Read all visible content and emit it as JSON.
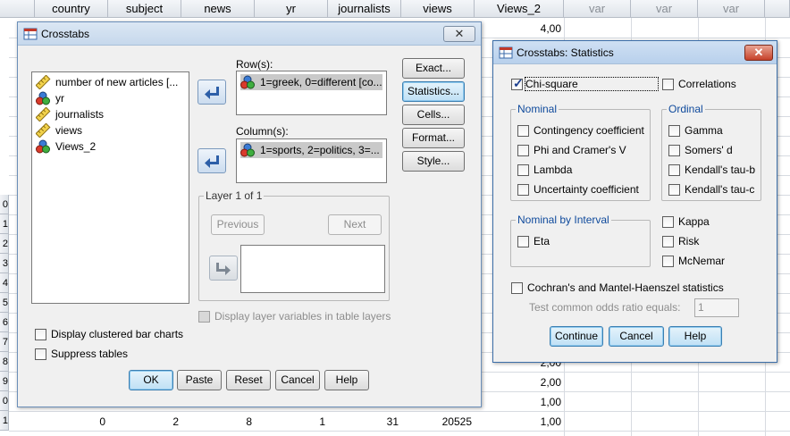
{
  "spreadsheet": {
    "columns": [
      "country",
      "subject",
      "news",
      "yr",
      "journalists",
      "views",
      "Views_2",
      "var",
      "var",
      "var"
    ],
    "row_numbers": [
      "",
      "",
      "",
      "",
      "",
      "",
      "",
      "",
      "",
      "",
      "0",
      "1",
      "2",
      "3",
      "4",
      "5",
      "6",
      "7",
      "8",
      "9",
      "0",
      "1"
    ],
    "views2_top": "4,00",
    "views2_bottom": [
      "2,00",
      "2,00",
      "1,00",
      "1,00"
    ],
    "last_row": [
      "0",
      "2",
      "8",
      "1",
      "31",
      "20525"
    ]
  },
  "crosstabs": {
    "title": "Crosstabs",
    "close": "✕",
    "variables": [
      {
        "name": "number of new articles [...",
        "icon": "ruler-icon"
      },
      {
        "name": "yr",
        "icon": "nominal-icon"
      },
      {
        "name": "journalists",
        "icon": "ruler-icon"
      },
      {
        "name": "views",
        "icon": "ruler-icon"
      },
      {
        "name": "Views_2",
        "icon": "nominal-icon"
      }
    ],
    "rows_label": "Row(s):",
    "row_item": "1=greek, 0=different [co...",
    "columns_label": "Column(s):",
    "column_item": "1=sports, 2=politics, 3=...",
    "layer_label": "Layer 1 of 1",
    "previous": "Previous",
    "next": "Next",
    "display_layer": "Display layer variables in table layers",
    "side_buttons": [
      "Exact...",
      "Statistics...",
      "Cells...",
      "Format...",
      "Style..."
    ],
    "display_clustered": "Display clustered bar charts",
    "suppress_tables": "Suppress tables",
    "bottom_buttons": [
      "OK",
      "Paste",
      "Reset",
      "Cancel",
      "Help"
    ]
  },
  "statistics": {
    "title": "Crosstabs: Statistics",
    "close": "✕",
    "chi_square": "Chi-square",
    "correlations": "Correlations",
    "nominal_legend": "Nominal",
    "nominal": [
      "Contingency coefficient",
      "Phi and Cramer's V",
      "Lambda",
      "Uncertainty coefficient"
    ],
    "ordinal_legend": "Ordinal",
    "ordinal": [
      "Gamma",
      "Somers' d",
      "Kendall's tau-b",
      "Kendall's tau-c"
    ],
    "interval_legend": "Nominal by Interval",
    "eta": "Eta",
    "kappa": "Kappa",
    "risk": "Risk",
    "mcnemar": "McNemar",
    "cochran": "Cochran's and Mantel-Haenszel statistics",
    "test_odds_label": "Test common odds ratio equals:",
    "test_odds_value": "1",
    "buttons": [
      "Continue",
      "Cancel",
      "Help"
    ]
  }
}
